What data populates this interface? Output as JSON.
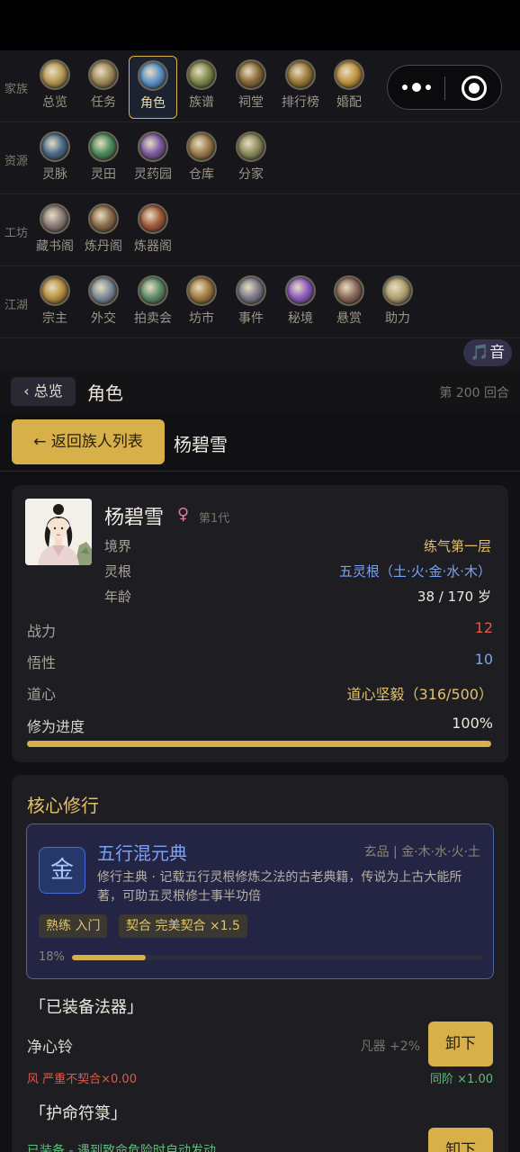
{
  "nav": {
    "rows": [
      {
        "label": "家族",
        "items": [
          {
            "label": "总览",
            "icon": "overview-icon",
            "color": "#b89a55"
          },
          {
            "label": "任务",
            "icon": "task-icon",
            "color": "#a0885a"
          },
          {
            "label": "角色",
            "icon": "character-icon",
            "color": "#5a90c8",
            "active": true
          },
          {
            "label": "族谱",
            "icon": "family-tree-icon",
            "color": "#7d8a4a"
          },
          {
            "label": "祠堂",
            "icon": "ancestral-hall-icon",
            "color": "#8a6a3a"
          },
          {
            "label": "排行榜",
            "icon": "ranking-icon",
            "color": "#9a7a3a"
          },
          {
            "label": "婚配",
            "icon": "marriage-icon",
            "color": "#c09440"
          }
        ]
      },
      {
        "label": "资源",
        "items": [
          {
            "label": "灵脉",
            "icon": "spirit-vein-icon",
            "color": "#4a6a8a"
          },
          {
            "label": "灵田",
            "icon": "spirit-field-icon",
            "color": "#4a8a5a"
          },
          {
            "label": "灵药园",
            "icon": "herb-garden-icon",
            "color": "#7a5aa0"
          },
          {
            "label": "仓库",
            "icon": "warehouse-icon",
            "color": "#9a7a4a"
          },
          {
            "label": "分家",
            "icon": "branch-family-icon",
            "color": "#8a8a5a"
          }
        ]
      },
      {
        "label": "工坊",
        "items": [
          {
            "label": "藏书阁",
            "icon": "library-icon",
            "color": "#8a7a7a"
          },
          {
            "label": "炼丹阁",
            "icon": "alchemy-icon",
            "color": "#8a6a4a"
          },
          {
            "label": "炼器阁",
            "icon": "forge-icon",
            "color": "#a05a3a"
          }
        ]
      },
      {
        "label": "江湖",
        "items": [
          {
            "label": "宗主",
            "icon": "sect-master-icon",
            "color": "#b89040"
          },
          {
            "label": "外交",
            "icon": "diplomacy-icon",
            "color": "#7a8a9a"
          },
          {
            "label": "拍卖会",
            "icon": "auction-icon",
            "color": "#5a8a6a"
          },
          {
            "label": "坊市",
            "icon": "market-icon",
            "color": "#a07a40"
          },
          {
            "label": "事件",
            "icon": "event-icon",
            "color": "#7a7a8a"
          },
          {
            "label": "秘境",
            "icon": "secret-realm-icon",
            "color": "#8a5ac0"
          },
          {
            "label": "悬赏",
            "icon": "bounty-icon",
            "color": "#8a6a5a"
          },
          {
            "label": "助力",
            "icon": "assist-icon",
            "color": "#b0a070"
          }
        ]
      }
    ]
  },
  "music_button": "🎵音",
  "subnav": {
    "back_label": "‹ 总览",
    "title": "角色",
    "round": "第 200 回合"
  },
  "hero": {
    "return_label": "← 返回族人列表",
    "name": "杨碧雪"
  },
  "profile": {
    "name": "杨碧雪",
    "gender_symbol": "♀",
    "generation": "第1代",
    "realm_label": "境界",
    "realm_value": "练气第一层",
    "root_label": "灵根",
    "root_value": "五灵根（土·火·金·水·木）",
    "age_label": "年龄",
    "age_value": "38 / 170 岁",
    "power_label": "战力",
    "power_value": "12",
    "wisdom_label": "悟性",
    "wisdom_value": "10",
    "heart_label": "道心",
    "heart_value": "道心坚毅（316/500）",
    "cultivation_label": "修为进度",
    "cultivation_value": "100%",
    "cultivation_progress": 1.0
  },
  "core": {
    "title": "核心修行",
    "skill": {
      "badge": "金",
      "name": "五行混元典",
      "meta": "玄品 | 金·木·水·火·土",
      "desc": "修行主典 · 记载五行灵根修炼之法的古老典籍，传说为上古大能所著，可助五灵根修士事半功倍",
      "tag1": "熟练 入门",
      "tag2": "契合 完美契合 ×1.5",
      "progress_label": "18%",
      "progress": 0.18
    },
    "artifact_title": "「已装备法器」",
    "artifact": {
      "name": "净心铃",
      "meta": "凡器 +2%",
      "button": "卸下",
      "warn": "风 严重不契合×0.00",
      "ok": "同阶 ×1.00"
    },
    "talisman_title": "「护命符箓」",
    "talisman": {
      "note": "已装备 - 遇到致命危险时自动发动",
      "button": "卸下"
    }
  },
  "colors": {
    "accent": "#d8b04a",
    "blue": "#7aa2f4",
    "red": "#e05a4a",
    "green": "#5fbf7a"
  }
}
